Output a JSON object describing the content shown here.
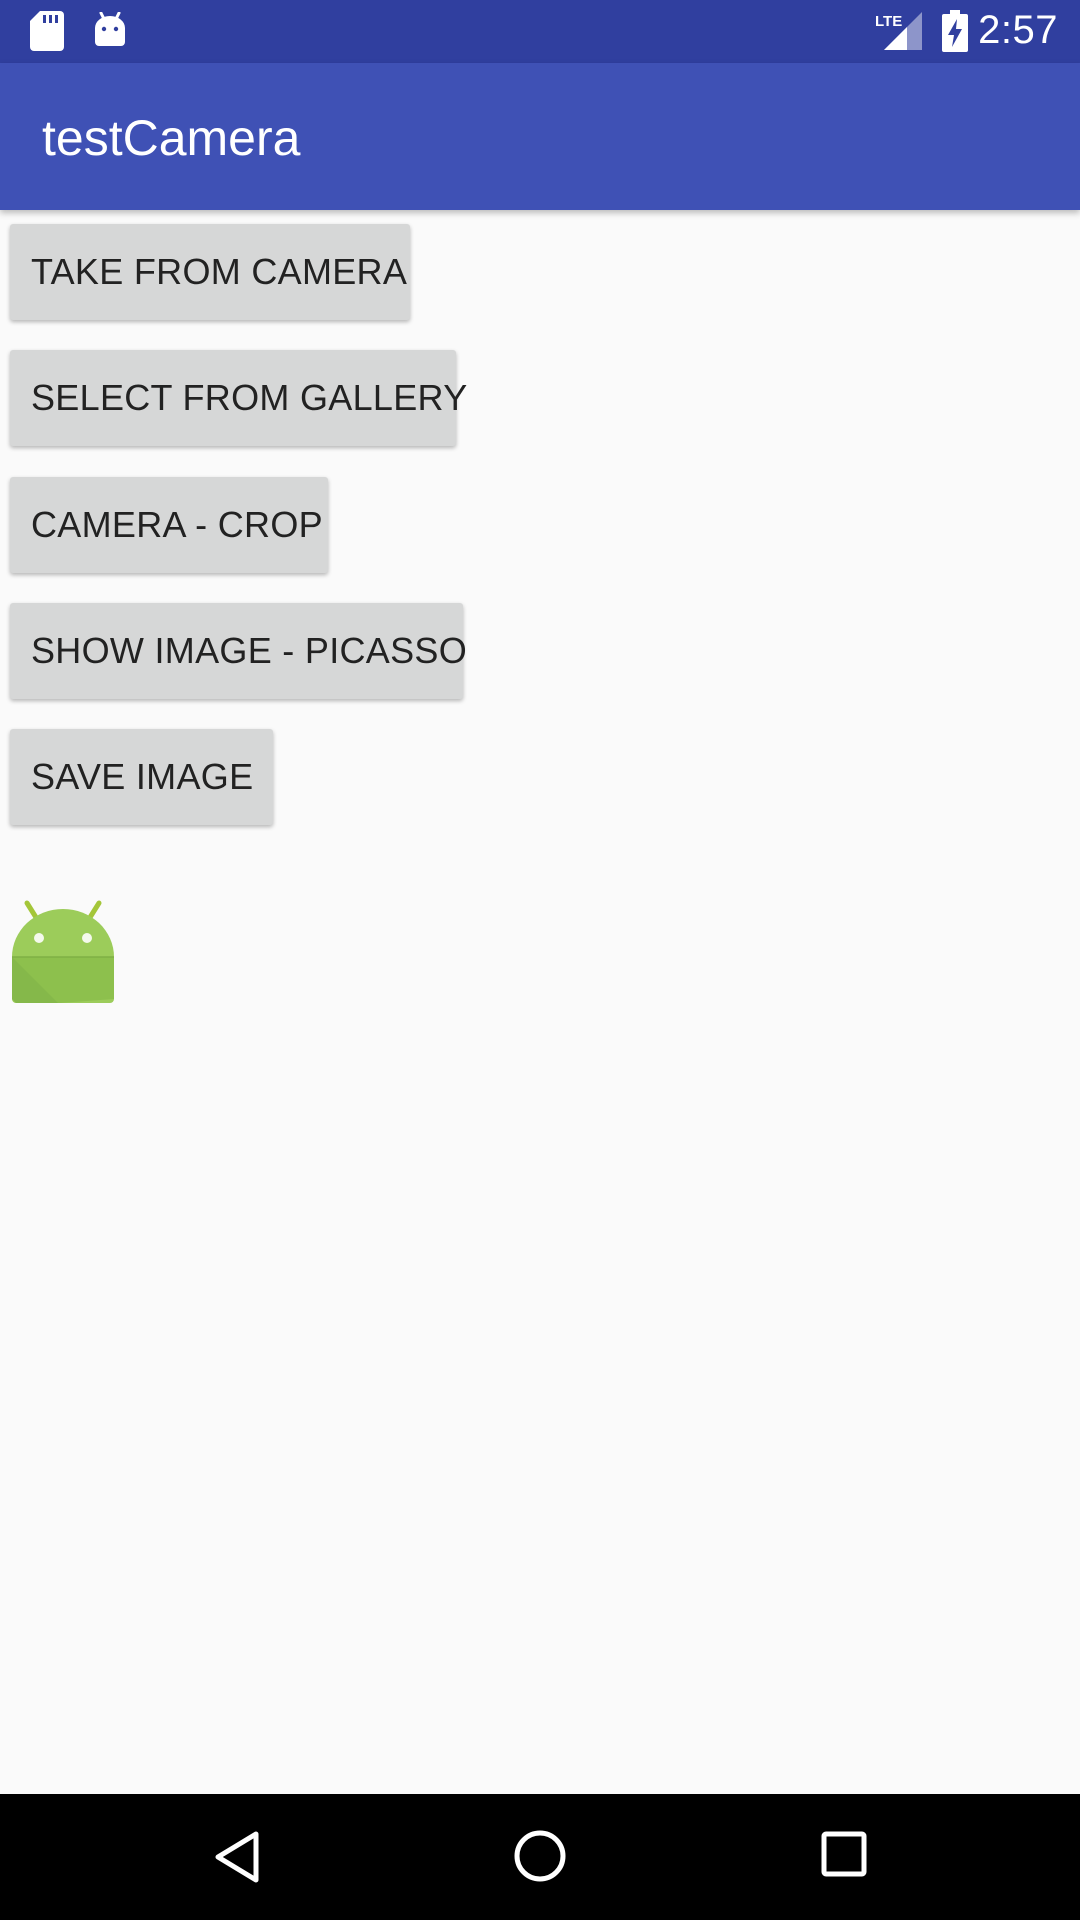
{
  "status_bar": {
    "time": "2:57",
    "network_label": "LTE",
    "icons": [
      "sd-card-icon",
      "android-notification-icon",
      "lte-signal-icon",
      "battery-charging-icon"
    ]
  },
  "app_bar": {
    "title": "testCamera"
  },
  "buttons": {
    "take_from_camera": "TAKE FROM CAMERA",
    "select_from_gallery": "SELECT FROM GALLERY",
    "camera_crop": "CAMERA - CROP",
    "show_image_picasso": "SHOW IMAGE - PICASSO",
    "save_image": "SAVE IMAGE"
  },
  "image": {
    "icon": "android-launcher-icon"
  },
  "nav_bar": {
    "icons": [
      "back-icon",
      "home-icon",
      "recents-icon"
    ]
  },
  "colors": {
    "status_bar": "#303f9f",
    "app_bar": "#3f51b5",
    "background": "#fafafa",
    "button": "#d6d7d7",
    "android_green": "#a4c639"
  }
}
